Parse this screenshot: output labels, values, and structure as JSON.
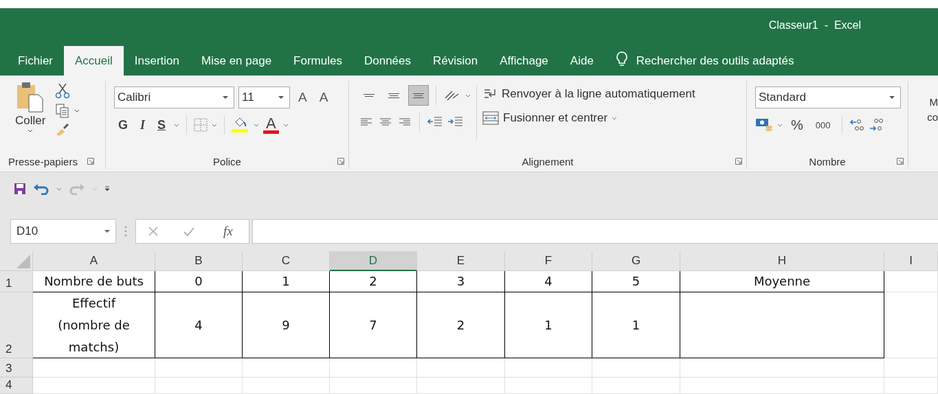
{
  "window": {
    "title": "Classeur1  -  Excel"
  },
  "tabs": [
    {
      "label": "Fichier",
      "selected": false
    },
    {
      "label": "Accueil",
      "selected": true
    },
    {
      "label": "Insertion",
      "selected": false
    },
    {
      "label": "Mise en page",
      "selected": false
    },
    {
      "label": "Formules",
      "selected": false
    },
    {
      "label": "Données",
      "selected": false
    },
    {
      "label": "Révision",
      "selected": false
    },
    {
      "label": "Affichage",
      "selected": false
    },
    {
      "label": "Aide",
      "selected": false
    }
  ],
  "tell_me": "Rechercher des outils adaptés",
  "ribbon": {
    "clipboard": {
      "paste_label": "Coller",
      "group_label": "Presse-papiers"
    },
    "font": {
      "font_name": "Calibri",
      "font_size": "11",
      "grow_label": "A",
      "shrink_label": "A",
      "bold_label": "G",
      "italic_label": "I",
      "underline_label": "S",
      "color_label": "A",
      "group_label": "Police"
    },
    "alignment": {
      "vertical": [
        {
          "kind": "top",
          "selected": false
        },
        {
          "kind": "middle",
          "selected": false
        },
        {
          "kind": "bottom",
          "selected": true
        }
      ],
      "wrap_label": "Renvoyer à la ligne automatiquement",
      "merge_label": "Fusionner et centrer",
      "group_label": "Alignement"
    },
    "number": {
      "format": "Standard",
      "percent_label": "%",
      "thousands_label": "000",
      "group_label": "Nombre"
    },
    "cut_off_lines": [
      "M",
      "co"
    ]
  },
  "formula_bar": {
    "name_box": "D10",
    "function_label": "fx"
  },
  "grid": {
    "columns": [
      {
        "label": "A",
        "selected": false
      },
      {
        "label": "B",
        "selected": false
      },
      {
        "label": "C",
        "selected": false
      },
      {
        "label": "D",
        "selected": true
      },
      {
        "label": "E",
        "selected": false
      },
      {
        "label": "F",
        "selected": false
      },
      {
        "label": "G",
        "selected": false
      },
      {
        "label": "H",
        "selected": false
      },
      {
        "label": "I",
        "selected": false
      }
    ],
    "rows": [
      {
        "header": "1",
        "bordered": true,
        "cells": [
          "Nombre de buts",
          "0",
          "1",
          "2",
          "3",
          "4",
          "5",
          "Moyenne"
        ]
      },
      {
        "header": "2",
        "bordered": true,
        "cells": [
          "Effectif\n(nombre de\nmatchs)",
          "4",
          "9",
          "7",
          "2",
          "1",
          "1"
        ]
      },
      {
        "header": "3",
        "bordered": false,
        "cells": []
      },
      {
        "header": "4",
        "bordered": false,
        "cells": []
      }
    ]
  }
}
